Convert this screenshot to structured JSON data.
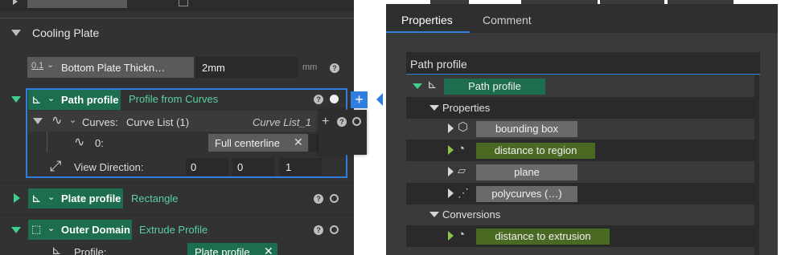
{
  "left_panel": {
    "section_title": "Cooling Plate",
    "bottom_plate": {
      "badge": "0.1",
      "label": "Bottom Plate Thickn…",
      "value": "2mm",
      "unit": "mm"
    },
    "path_profile": {
      "label": "Path profile",
      "type": "Profile from Curves",
      "curves": {
        "label": "Curves:",
        "value": "Curve List (1)",
        "ref": "Curve List_1"
      },
      "item0": {
        "label": "0:",
        "chip": "Full centerline"
      },
      "view_direction": {
        "label": "View Direction:",
        "x": "0",
        "y": "0",
        "z": "1"
      }
    },
    "plate_profile": {
      "label": "Plate profile",
      "type": "Rectangle"
    },
    "outer_domain": {
      "label": "Outer Domain",
      "type": "Extrude Profile"
    },
    "profile_row": {
      "label": "Profile:",
      "chip": "Plate profile"
    }
  },
  "right_panel": {
    "tabs": [
      "Properties",
      "Comment"
    ],
    "section_header": "Path profile",
    "root_node": "Path profile",
    "groups": {
      "properties": "Properties",
      "conversions": "Conversions"
    },
    "property_items": [
      "bounding box",
      "distance to region",
      "plane",
      "polycurves (…)"
    ],
    "conversion_items": [
      "distance to extrusion"
    ]
  },
  "colors": {
    "accent_blue": "#2f7fe0",
    "green_chip": "#1d6e4f",
    "olive_chip": "#4a6a24",
    "grey_chip": "#6a6a6a"
  }
}
